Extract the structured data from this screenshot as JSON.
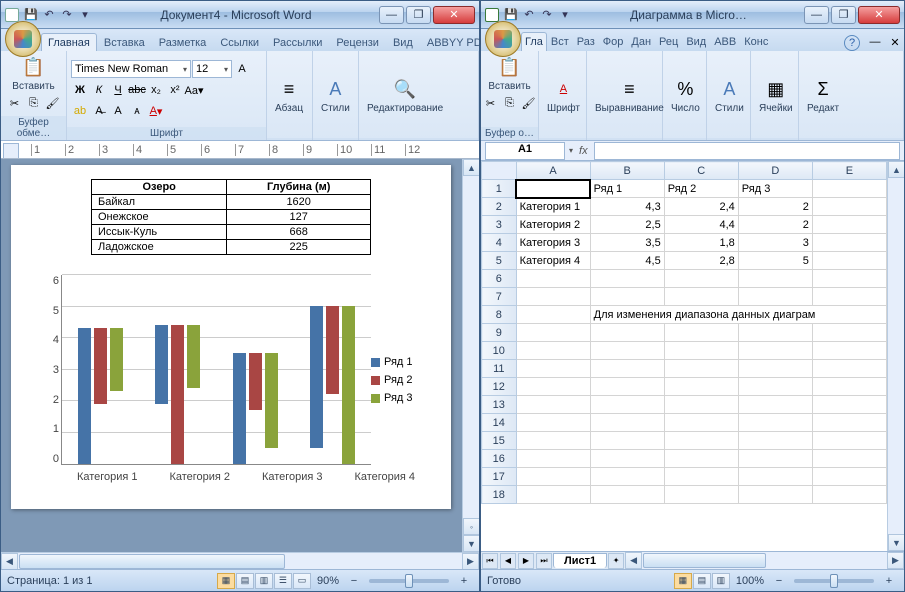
{
  "word": {
    "title": "Документ4 - Microsoft Word",
    "tabs": [
      "Главная",
      "Вставка",
      "Разметка",
      "Ссылки",
      "Рассылки",
      "Рецензи",
      "Вид",
      "ABBYY PD"
    ],
    "ribbon": {
      "clipboard_label": "Буфер обме…",
      "paste": "Вставить",
      "font": "Times New Roman",
      "size": "12",
      "font_label": "Шрифт",
      "para": "Абзац",
      "styles": "Стили",
      "editing": "Редактирование"
    },
    "status": {
      "page": "Страница: 1 из 1",
      "zoom": "90%"
    },
    "doc_table": {
      "headers": [
        "Озеро",
        "Глубина (м)"
      ],
      "rows": [
        [
          "Байкал",
          "1620"
        ],
        [
          "Онежское",
          "127"
        ],
        [
          "Иссык-Куль",
          "668"
        ],
        [
          "Ладожское",
          "225"
        ]
      ]
    }
  },
  "excel": {
    "title": "Диаграмма в Micro…",
    "tabs": [
      "Гла",
      "Вст",
      "Раз",
      "Фор",
      "Дан",
      "Рец",
      "Вид",
      "ABB",
      "Конс"
    ],
    "ribbon": {
      "clipboard": "Буфер о…",
      "paste": "Вставить",
      "font": "Шрифт",
      "align": "Выравнивание",
      "number": "Число",
      "styles": "Стили",
      "cells": "Ячейки",
      "edit": "Редакт"
    },
    "namebox": "A1",
    "grid": {
      "col_headers": [
        "A",
        "B",
        "C",
        "D",
        "E"
      ],
      "rows": [
        [
          "",
          "Ряд 1",
          "Ряд 2",
          "Ряд 3",
          ""
        ],
        [
          "Категория 1",
          "4,3",
          "2,4",
          "2",
          ""
        ],
        [
          "Категория 2",
          "2,5",
          "4,4",
          "2",
          ""
        ],
        [
          "Категория 3",
          "3,5",
          "1,8",
          "3",
          ""
        ],
        [
          "Категория 4",
          "4,5",
          "2,8",
          "5",
          ""
        ],
        [
          "",
          "",
          "",
          "",
          ""
        ],
        [
          "",
          "",
          "",
          "",
          ""
        ],
        [
          "",
          "Для изменения диапазона данных диаграм",
          "",
          "",
          ""
        ],
        [
          "",
          "",
          "",
          "",
          ""
        ],
        [
          "",
          "",
          "",
          "",
          ""
        ],
        [
          "",
          "",
          "",
          "",
          ""
        ],
        [
          "",
          "",
          "",
          "",
          ""
        ],
        [
          "",
          "",
          "",
          "",
          ""
        ],
        [
          "",
          "",
          "",
          "",
          ""
        ],
        [
          "",
          "",
          "",
          "",
          ""
        ],
        [
          "",
          "",
          "",
          "",
          ""
        ],
        [
          "",
          "",
          "",
          "",
          ""
        ],
        [
          "",
          "",
          "",
          "",
          ""
        ]
      ]
    },
    "sheet_tab": "Лист1",
    "status": {
      "ready": "Готово",
      "zoom": "100%"
    }
  },
  "chart_data": {
    "type": "bar",
    "categories": [
      "Категория 1",
      "Категория 2",
      "Категория 3",
      "Категория 4"
    ],
    "series": [
      {
        "name": "Ряд 1",
        "values": [
          4.3,
          2.5,
          3.5,
          4.5
        ],
        "color": "#4573a7"
      },
      {
        "name": "Ряд 2",
        "values": [
          2.4,
          4.4,
          1.8,
          2.8
        ],
        "color": "#a94644"
      },
      {
        "name": "Ряд 3",
        "values": [
          2,
          2,
          3,
          5
        ],
        "color": "#8aa33b"
      }
    ],
    "ylim": [
      0,
      6
    ],
    "yticks": [
      0,
      1,
      2,
      3,
      4,
      5,
      6
    ]
  }
}
